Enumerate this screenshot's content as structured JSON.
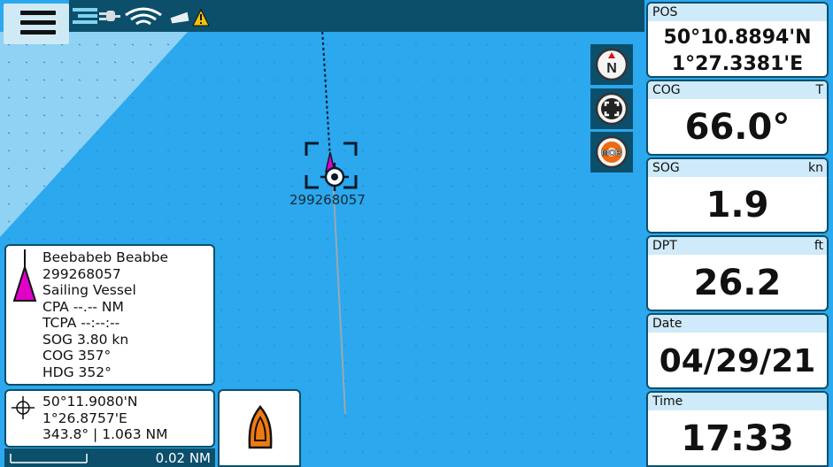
{
  "colors": {
    "water": "#2ba8ee",
    "shallow": "#8fd2f3",
    "dark": "#0c4f6b",
    "magenta": "#e000c8",
    "header_bg": "#cfeaf8"
  },
  "status_icons": [
    "ais-icon",
    "plug-icon",
    "wifi-icon",
    "boat-alert-icon"
  ],
  "map_buttons": [
    {
      "name": "north-up-button",
      "icon": "north-icon",
      "label": "N"
    },
    {
      "name": "center-button",
      "icon": "expand-icon"
    },
    {
      "name": "mob-button",
      "icon": "mob-icon",
      "label": "MOB"
    }
  ],
  "target": {
    "mmsi_label": "299268057"
  },
  "panels": {
    "pos": {
      "label": "POS",
      "lat": "50°10.8894'N",
      "lon": "1°27.3381'E"
    },
    "cog": {
      "label": "COG",
      "unit": "T",
      "value": "66.0°"
    },
    "sog": {
      "label": "SOG",
      "unit": "kn",
      "value": "1.9"
    },
    "dpt": {
      "label": "DPT",
      "unit": "ft",
      "value": "26.2"
    },
    "date": {
      "label": "Date",
      "value": "04/29/21"
    },
    "time": {
      "label": "Time",
      "value": "17:33"
    }
  },
  "vessel_info": {
    "name": "Beebabeb Beabbe",
    "mmsi": "299268057",
    "type": "Sailing Vessel",
    "cpa": "CPA --.-- NM",
    "tcpa": "TCPA --:--:--",
    "sog": "SOG 3.80 kn",
    "cog": "COG 357°",
    "hdg": "HDG 352°"
  },
  "cursor": {
    "lat": "50°11.9080'N",
    "lon": "1°26.8757'E",
    "bearing_range": "343.8° | 1.063 NM"
  },
  "scale": {
    "label": "0.02 NM"
  }
}
